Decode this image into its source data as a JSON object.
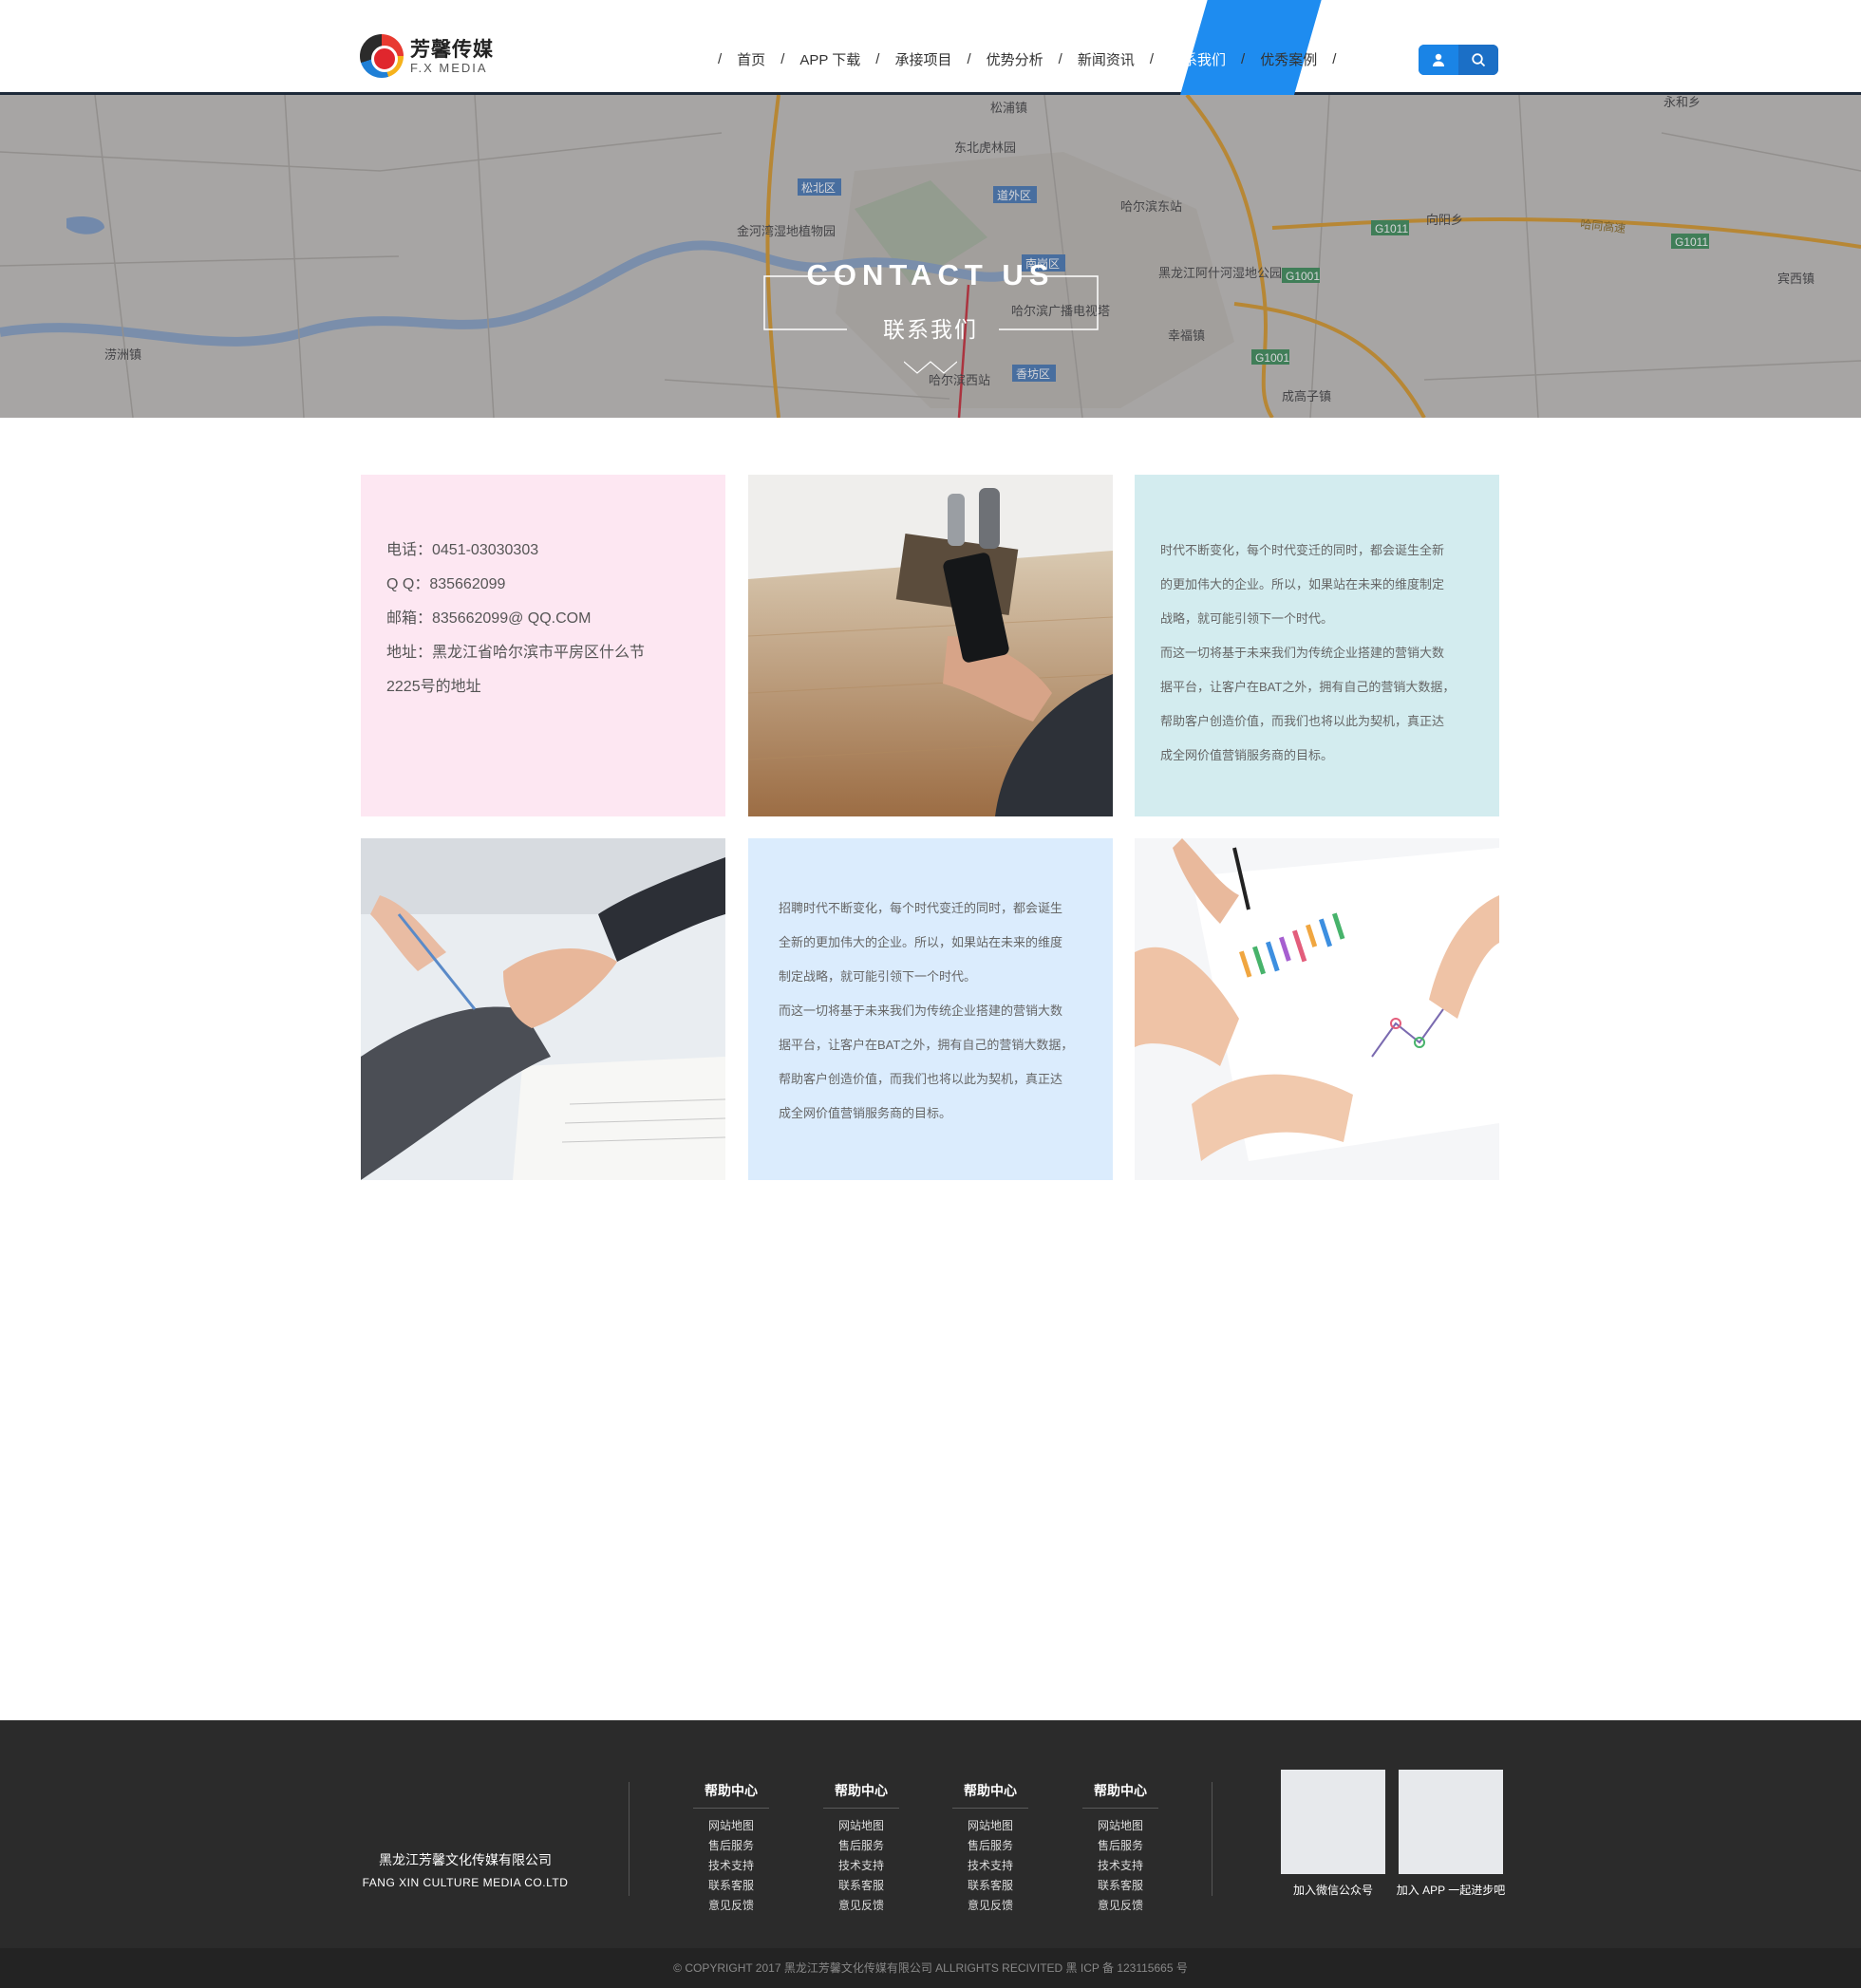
{
  "brand": {
    "name_cn": "芳馨传媒",
    "name_en": "F.X MEDIA"
  },
  "nav": {
    "items": [
      {
        "label": "首页",
        "active": false
      },
      {
        "label": "APP 下载",
        "active": false
      },
      {
        "label": "承接项目",
        "active": false
      },
      {
        "label": "优势分析",
        "active": false
      },
      {
        "label": "新闻资讯",
        "active": false
      },
      {
        "label": "联系我们",
        "active": true
      },
      {
        "label": "优秀案例",
        "active": false
      }
    ],
    "separator": "/",
    "active_color": "#1e8cf0"
  },
  "header_actions": {
    "user_icon": "user-icon",
    "search_icon": "search-icon"
  },
  "banner": {
    "title": "CONTACT US",
    "subtitle": "联系我们",
    "map_labels": [
      "松浦镇",
      "东北虎林园",
      "松北区",
      "道外区",
      "哈尔滨东站",
      "金河湾湿地植物园",
      "南岗区",
      "黑龙江阿什河湿地公园",
      "哈尔滨广播电视塔",
      "幸福镇",
      "香坊区",
      "哈尔滨西站",
      "成高子镇",
      "向阳乡",
      "宾西镇",
      "永和乡",
      "涝洲镇",
      "哈同高速",
      "G1011",
      "G1001"
    ]
  },
  "contact": {
    "phone": "电话：0451-03030303",
    "qq": "Q Q：835662099",
    "email": "邮箱：835662099@ QQ.COM",
    "address_1": "地址：黑龙江省哈尔滨市平房区什么节",
    "address_2": "2225号的地址"
  },
  "about_text": {
    "lines": [
      "时代不断变化，每个时代变迁的同时，都会诞生全新",
      "的更加伟大的企业。所以，如果站在未来的维度制定",
      "战略，就可能引领下一个时代。",
      "而这一切将基于未来我们为传统企业搭建的营销大数",
      "据平台，让客户在BAT之外，拥有自己的营销大数据，",
      "帮助客户创造价值，而我们也将以此为契机，真正达",
      "成全网价值营销服务商的目标。"
    ]
  },
  "recruit_text": {
    "lines": [
      "招聘时代不断变化，每个时代变迁的同时，都会诞生",
      "全新的更加伟大的企业。所以，如果站在未来的维度",
      "制定战略，就可能引领下一个时代。",
      "而这一切将基于未来我们为传统企业搭建的营销大数",
      "据平台，让客户在BAT之外，拥有自己的营销大数据，",
      "帮助客户创造价值，而我们也将以此为契机，真正达",
      "成全网价值营销服务商的目标。"
    ]
  },
  "photos": {
    "phone_photo_icon": "smartphone-photo",
    "handshake_photo_icon": "handshake-photo",
    "chart_photo_icon": "chart-analysis-photo"
  },
  "footer": {
    "company_cn": "黑龙江芳馨文化传媒有限公司",
    "company_en": "FANG XIN CULTURE MEDIA CO.LTD",
    "columns": [
      {
        "heading": "帮助中心",
        "links": [
          "网站地图",
          "售后服务",
          "技术支持",
          "联系客服",
          "意见反馈"
        ]
      },
      {
        "heading": "帮助中心",
        "links": [
          "网站地图",
          "售后服务",
          "技术支持",
          "联系客服",
          "意见反馈"
        ]
      },
      {
        "heading": "帮助中心",
        "links": [
          "网站地图",
          "售后服务",
          "技术支持",
          "联系客服",
          "意见反馈"
        ]
      },
      {
        "heading": "帮助中心",
        "links": [
          "网站地图",
          "售后服务",
          "技术支持",
          "联系客服",
          "意见反馈"
        ]
      }
    ],
    "qr": [
      {
        "label": "加入微信公众号"
      },
      {
        "label": "加入 APP 一起进步吧"
      }
    ],
    "copyright": "© COPYRIGHT 2017 黑龙江芳馨文化传媒有限公司 ALLRIGHTS RECIVITED 黑 ICP 备 123115665 号"
  }
}
